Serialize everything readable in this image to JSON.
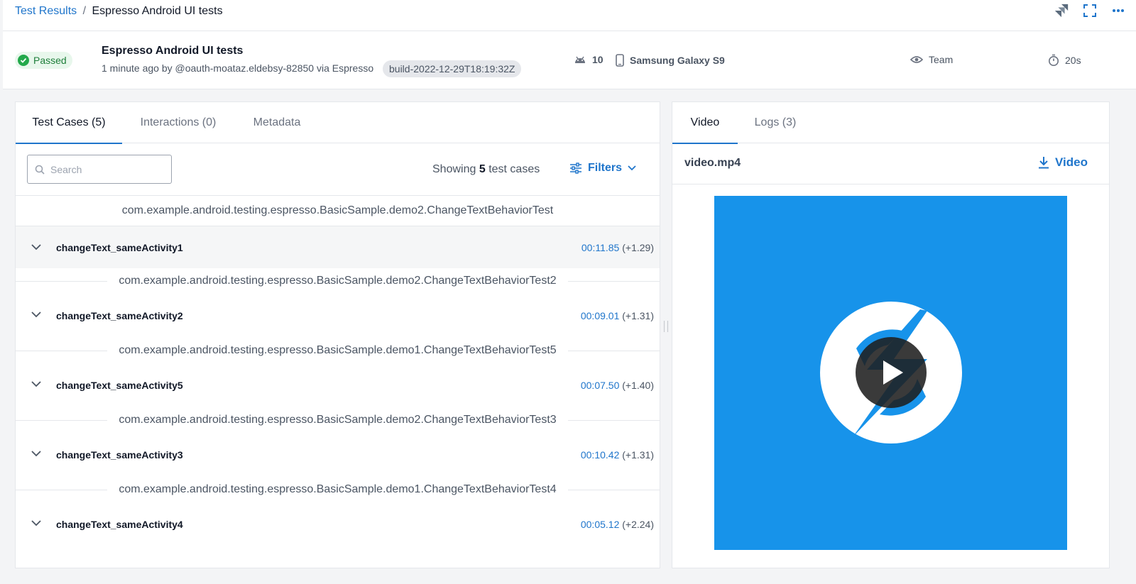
{
  "breadcrumb": {
    "link": "Test Results",
    "separator": "/",
    "current": "Espresso Android UI tests"
  },
  "top_icons": [
    "jira-icon",
    "fullscreen-icon",
    "more-icon"
  ],
  "summary": {
    "status": "Passed",
    "title": "Espresso Android UI tests",
    "subtitle": "1 minute ago by @oauth-moataz.eldebsy-82850 via Espresso",
    "build": "build-2022-12-29T18:19:32Z",
    "android_version": "10",
    "device": "Samsung Galaxy S9",
    "visibility": "Team",
    "duration": "20s"
  },
  "left_tabs": [
    {
      "label": "Test Cases (5)",
      "active": true
    },
    {
      "label": "Interactions (0)",
      "active": false
    },
    {
      "label": "Metadata",
      "active": false
    }
  ],
  "search": {
    "placeholder": "Search",
    "value": ""
  },
  "showing": {
    "prefix": "Showing",
    "count": "5",
    "suffix": "test cases"
  },
  "filters_label": "Filters",
  "groups": [
    {
      "suite": "com.example.android.testing.espresso.BasicSample.demo2.ChangeTextBehaviorTest",
      "case": "changeText_sameActivity1",
      "time": "00:11.85",
      "delta": "(+1.29)"
    },
    {
      "suite": "com.example.android.testing.espresso.BasicSample.demo2.ChangeTextBehaviorTest2",
      "case": "changeText_sameActivity2",
      "time": "00:09.01",
      "delta": "(+1.31)"
    },
    {
      "suite": "com.example.android.testing.espresso.BasicSample.demo1.ChangeTextBehaviorTest5",
      "case": "changeText_sameActivity5",
      "time": "00:07.50",
      "delta": "(+1.40)"
    },
    {
      "suite": "com.example.android.testing.espresso.BasicSample.demo2.ChangeTextBehaviorTest3",
      "case": "changeText_sameActivity3",
      "time": "00:10.42",
      "delta": "(+1.31)"
    },
    {
      "suite": "com.example.android.testing.espresso.BasicSample.demo1.ChangeTextBehaviorTest4",
      "case": "changeText_sameActivity4",
      "time": "00:05.12",
      "delta": "(+2.24)"
    }
  ],
  "right_tabs": [
    {
      "label": "Video",
      "active": true
    },
    {
      "label": "Logs (3)",
      "active": false
    }
  ],
  "video": {
    "filename": "video.mp4",
    "download_label": "Video"
  },
  "colors": {
    "accent": "#1f75cb",
    "passed": "#23a94b",
    "video_bg": "#1793ea"
  }
}
